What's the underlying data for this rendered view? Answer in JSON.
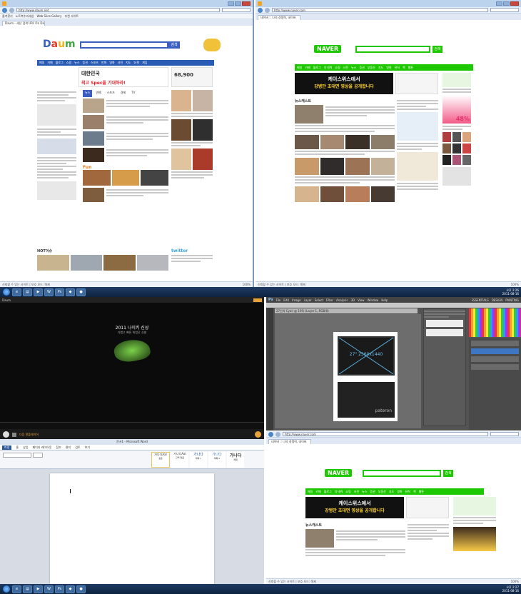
{
  "top": {
    "daum": {
      "title": "Daum - 세상 검색 URL On Daum",
      "url": "http://www.daum.net",
      "tab": "Daum - 세상 검색 URL On Daum",
      "fav": [
        "즐겨찾기",
        "노트북수리세상",
        "Web Slice Gallery",
        "추천 사이트"
      ],
      "logo": {
        "d": "D",
        "a": "a",
        "u": "u",
        "m": "m"
      },
      "search_btn": "검색",
      "nav": [
        "메일",
        "카페",
        "블로그",
        "쇼핑",
        "뉴스",
        "증권",
        "스포츠",
        "만화",
        "영화",
        "사전",
        "지도",
        "tv팟",
        "게임",
        "로그인"
      ],
      "banner": [
        "대한민국",
        "최고 Spec을 기대하라!"
      ],
      "price": "68,900",
      "ad_label": "지금 바로 확인",
      "section_tabs": [
        "뉴스",
        "연예",
        "스포츠",
        "경제",
        "TV"
      ],
      "hot_issue": "HOT이슈",
      "fun": "Fun",
      "twitter": "twitter",
      "status": "신뢰할 수 있는 사이트 | 보호 모드: 해제",
      "zoom": "100%"
    },
    "naver": {
      "title": "NAVER",
      "url": "http://www.naver.com",
      "tab": "네이버 :: 나의 경쟁력, 네이버",
      "logo": "NAVER",
      "search_btn": "검색",
      "nav": [
        "메일",
        "카페",
        "블로그",
        "지식iN",
        "쇼핑",
        "사전",
        "뉴스",
        "증권",
        "부동산",
        "지도",
        "영화",
        "뮤직",
        "책",
        "웹툰"
      ],
      "banner": [
        "케이스위스에서",
        "강병만 초대면 영상을 공개합니다"
      ],
      "news_label": "뉴스캐스트",
      "ad": [
        "48%"
      ],
      "status": "신뢰할 수 있는 사이트 | 보호 모드: 해제",
      "zoom": "100%"
    },
    "taskbar": {
      "time": "오후 2:26",
      "date": "2011-08-16"
    }
  },
  "bottom": {
    "media": {
      "title": "Daum",
      "headline": "2011 나이키 신상",
      "sub": "가볍고 빠른 최첨단 신발",
      "status": "다음 팟플레이어"
    },
    "photoshop": {
      "menu": [
        "File",
        "Edit",
        "Image",
        "Layer",
        "Select",
        "Filter",
        "Analysis",
        "3D",
        "View",
        "Window",
        "Help"
      ],
      "workspace": [
        "ESSENTIALS",
        "DESIGN",
        "PAINTING"
      ],
      "doc_tab": "27인치 Cyan @ 16% (Layer 1, RGB/8)",
      "canvas_label": "27\" 2560x1440",
      "brand": "pateron"
    },
    "word": {
      "title": "문서1 - Microsoft Word",
      "ribbon_tabs": [
        "파일",
        "홈",
        "삽입",
        "페이지 레이아웃",
        "참조",
        "편지",
        "검토",
        "보기"
      ],
      "styles": [
        "가나다AaI",
        "가나다AaI",
        "가나다",
        "가나다",
        "가나다"
      ],
      "style_labels": [
        "표준",
        "간격 없음",
        "제목 1",
        "제목 2",
        "제목"
      ]
    },
    "naver": {
      "url": "http://www.naver.com",
      "tab": "네이버 :: 나의 경쟁력, 네이버",
      "logo": "NAVER",
      "search_btn": "검색",
      "nav": [
        "메일",
        "카페",
        "블로그",
        "지식iN",
        "쇼핑",
        "사전",
        "뉴스",
        "증권",
        "부동산",
        "지도",
        "영화",
        "뮤직",
        "책",
        "웹툰"
      ],
      "banner": [
        "케이스위스에서",
        "강병만 초대면 영상을 공개합니다"
      ],
      "news_label": "뉴스캐스트",
      "status": "신뢰할 수 있는 사이트 | 보호 모드: 해제",
      "zoom": "100%"
    },
    "taskbar": {
      "time": "오후 2:27",
      "date": "2011-08-16"
    }
  }
}
